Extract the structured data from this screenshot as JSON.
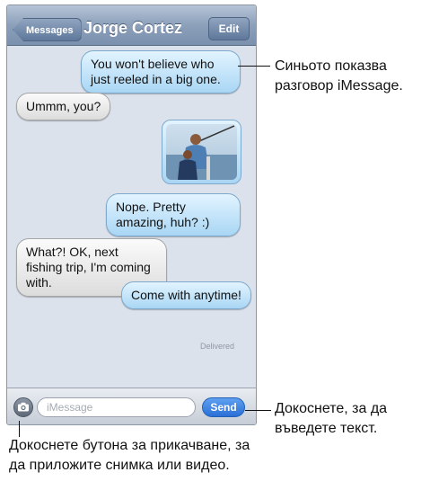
{
  "header": {
    "back_label": "Messages",
    "title": "Jorge Cortez",
    "edit_label": "Edit"
  },
  "messages": [
    {
      "side": "right",
      "color": "blue",
      "text": "You won't believe who just reeled in a big one."
    },
    {
      "side": "left",
      "color": "gray",
      "text": "Ummm, you?"
    },
    {
      "side": "right",
      "color": "blue",
      "type": "photo"
    },
    {
      "side": "right",
      "color": "blue",
      "text": "Nope. Pretty amazing, huh? :)"
    },
    {
      "side": "left",
      "color": "gray",
      "text": "What?! OK, next fishing trip, I'm coming with."
    },
    {
      "side": "right",
      "color": "blue",
      "text": "Come with anytime!"
    }
  ],
  "status": {
    "delivered": "Delivered"
  },
  "input": {
    "placeholder": "iMessage",
    "send_label": "Send",
    "camera_icon": "camera-icon"
  },
  "annotations": {
    "blue_bubble": "Синьото показва разговор iMessage.",
    "text_field": "Докоснете, за да въведете текст.",
    "attach_button": "Докоснете бутона за прикачване, за да приложите снимка или видео."
  },
  "colors": {
    "blue_bubble": "#a9d6f4",
    "gray_bubble": "#dcdcdc",
    "send_button": "#2a6fd6"
  }
}
